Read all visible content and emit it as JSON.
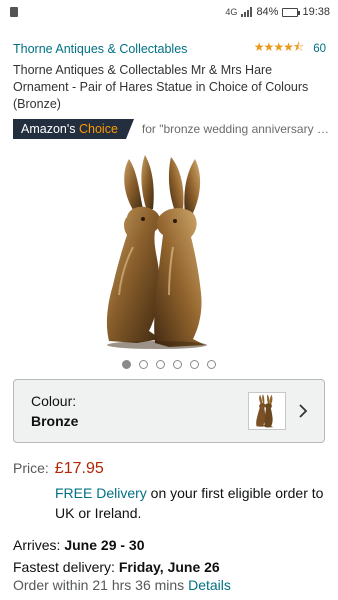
{
  "status_bar": {
    "network": "4G",
    "battery": "84%",
    "battery_level": 0.84,
    "time": "19:38"
  },
  "product": {
    "seller": "Thorne Antiques & Collectables",
    "rating_stars": 4.5,
    "rating_count": "60",
    "title": "Thorne Antiques & Collectables Mr & Mrs Hare Ornament - Pair of Hares Statue in Choice of Colours (Bronze)",
    "badge_prefix": "Amazon's",
    "badge_accent": "Choice",
    "badge_context": "for \"bronze wedding anniversary g…",
    "image_count": 6,
    "active_image": 0
  },
  "colour": {
    "label": "Colour:",
    "value": "Bronze"
  },
  "price": {
    "label": "Price:",
    "value": "£17.95"
  },
  "delivery": {
    "free_label": "FREE Delivery",
    "rest": " on your first eligible order to UK or Ireland."
  },
  "arrives": {
    "label": "Arrives: ",
    "dates": "June 29 - 30"
  },
  "fastest": {
    "label": "Fastest delivery: ",
    "date": "Friday, June 26"
  },
  "order_within": {
    "text": "Order within 21 hrs 36 mins ",
    "link": "Details"
  },
  "colors": {
    "link": "#007185",
    "price": "#b12704",
    "badge_bg": "#232f3e",
    "badge_accent": "#ff9900",
    "star": "#e89a1d"
  }
}
